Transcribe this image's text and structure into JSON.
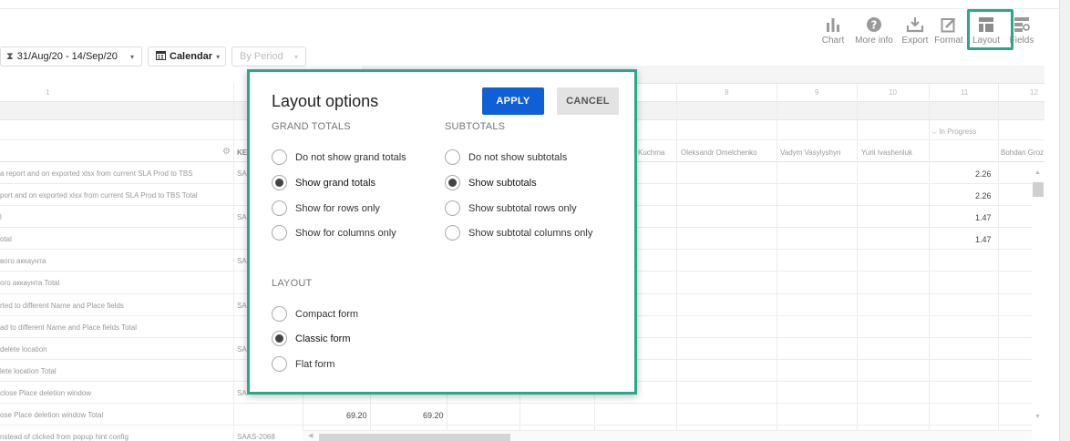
{
  "toolbar": {
    "items": [
      {
        "label": "Chart",
        "icon": "chart-icon"
      },
      {
        "label": "More info",
        "icon": "help-icon"
      },
      {
        "label": "Export",
        "icon": "export-icon"
      },
      {
        "label": "Format",
        "icon": "format-icon"
      },
      {
        "label": "Layout",
        "icon": "layout-icon"
      },
      {
        "label": "Fields",
        "icon": "fields-icon"
      }
    ]
  },
  "filters": {
    "date_range": "31/Aug/20 - 14/Sep/20",
    "calendar": "Calendar",
    "period_placeholder": "By Period"
  },
  "grid": {
    "col_numbers": [
      "1",
      "8",
      "9",
      "10",
      "11",
      "12"
    ],
    "key_header": "KE",
    "status_header": "In Progress",
    "name_headers": [
      "Kuchma",
      "Oleksandr Omelchenko",
      "Vadym Vasylyshyn",
      "Yurii Ivashenluk",
      "Bohdan Groz"
    ],
    "rows": [
      {
        "label": "a report and on exported xlsx from current SLA Prod to TBS",
        "key": "SA",
        "v11": "2.26"
      },
      {
        "label": "port and on exported xlsx from current SLA Prod to TBS Total",
        "key": "",
        "v11": "2.26"
      },
      {
        "label": "l",
        "key": "SA",
        "v11": "1.47"
      },
      {
        "label": "otal",
        "key": "",
        "v11": "1.47"
      },
      {
        "label": "вого аккаунта",
        "key": "SA",
        "v11": ""
      },
      {
        "label": "ого аккаунта Total",
        "key": "",
        "v11": ""
      },
      {
        "label": "rted to different Name and Place fields",
        "key": "SA",
        "v11": ""
      },
      {
        "label": "ad to different Name and Place fields Total",
        "key": "",
        "v11": ""
      },
      {
        "label": "delete location",
        "key": "SA",
        "v11": ""
      },
      {
        "label": "lete location Total",
        "key": "",
        "v11": ""
      },
      {
        "label": "close Place deletion window",
        "key": "SA",
        "v11": ""
      },
      {
        "label": "ose Place deletion window Total",
        "key": "",
        "v11": ""
      },
      {
        "label": "nstead of clicked from popup hint config",
        "key": "SAAS-2068",
        "v11": ""
      }
    ],
    "bottom_values": [
      "69.20",
      "69.20"
    ]
  },
  "dialog": {
    "title": "Layout options",
    "apply_label": "APPLY",
    "cancel_label": "CANCEL",
    "grand_totals": {
      "title": "GRAND TOTALS",
      "options": [
        "Do not show grand totals",
        "Show grand totals",
        "Show for rows only",
        "Show for columns only"
      ],
      "selected": "Show grand totals"
    },
    "subtotals": {
      "title": "SUBTOTALS",
      "options": [
        "Do not show subtotals",
        "Show subtotals",
        "Show subtotal rows only",
        "Show subtotal columns only"
      ],
      "selected": "Show subtotals"
    },
    "layout": {
      "title": "LAYOUT",
      "options": [
        "Compact form",
        "Classic form",
        "Flat form"
      ],
      "selected": "Classic form"
    }
  },
  "colors": {
    "accent_highlight": "#2aa88a",
    "apply_button": "#0f5fd6",
    "cancel_button": "#e3e3e3"
  }
}
